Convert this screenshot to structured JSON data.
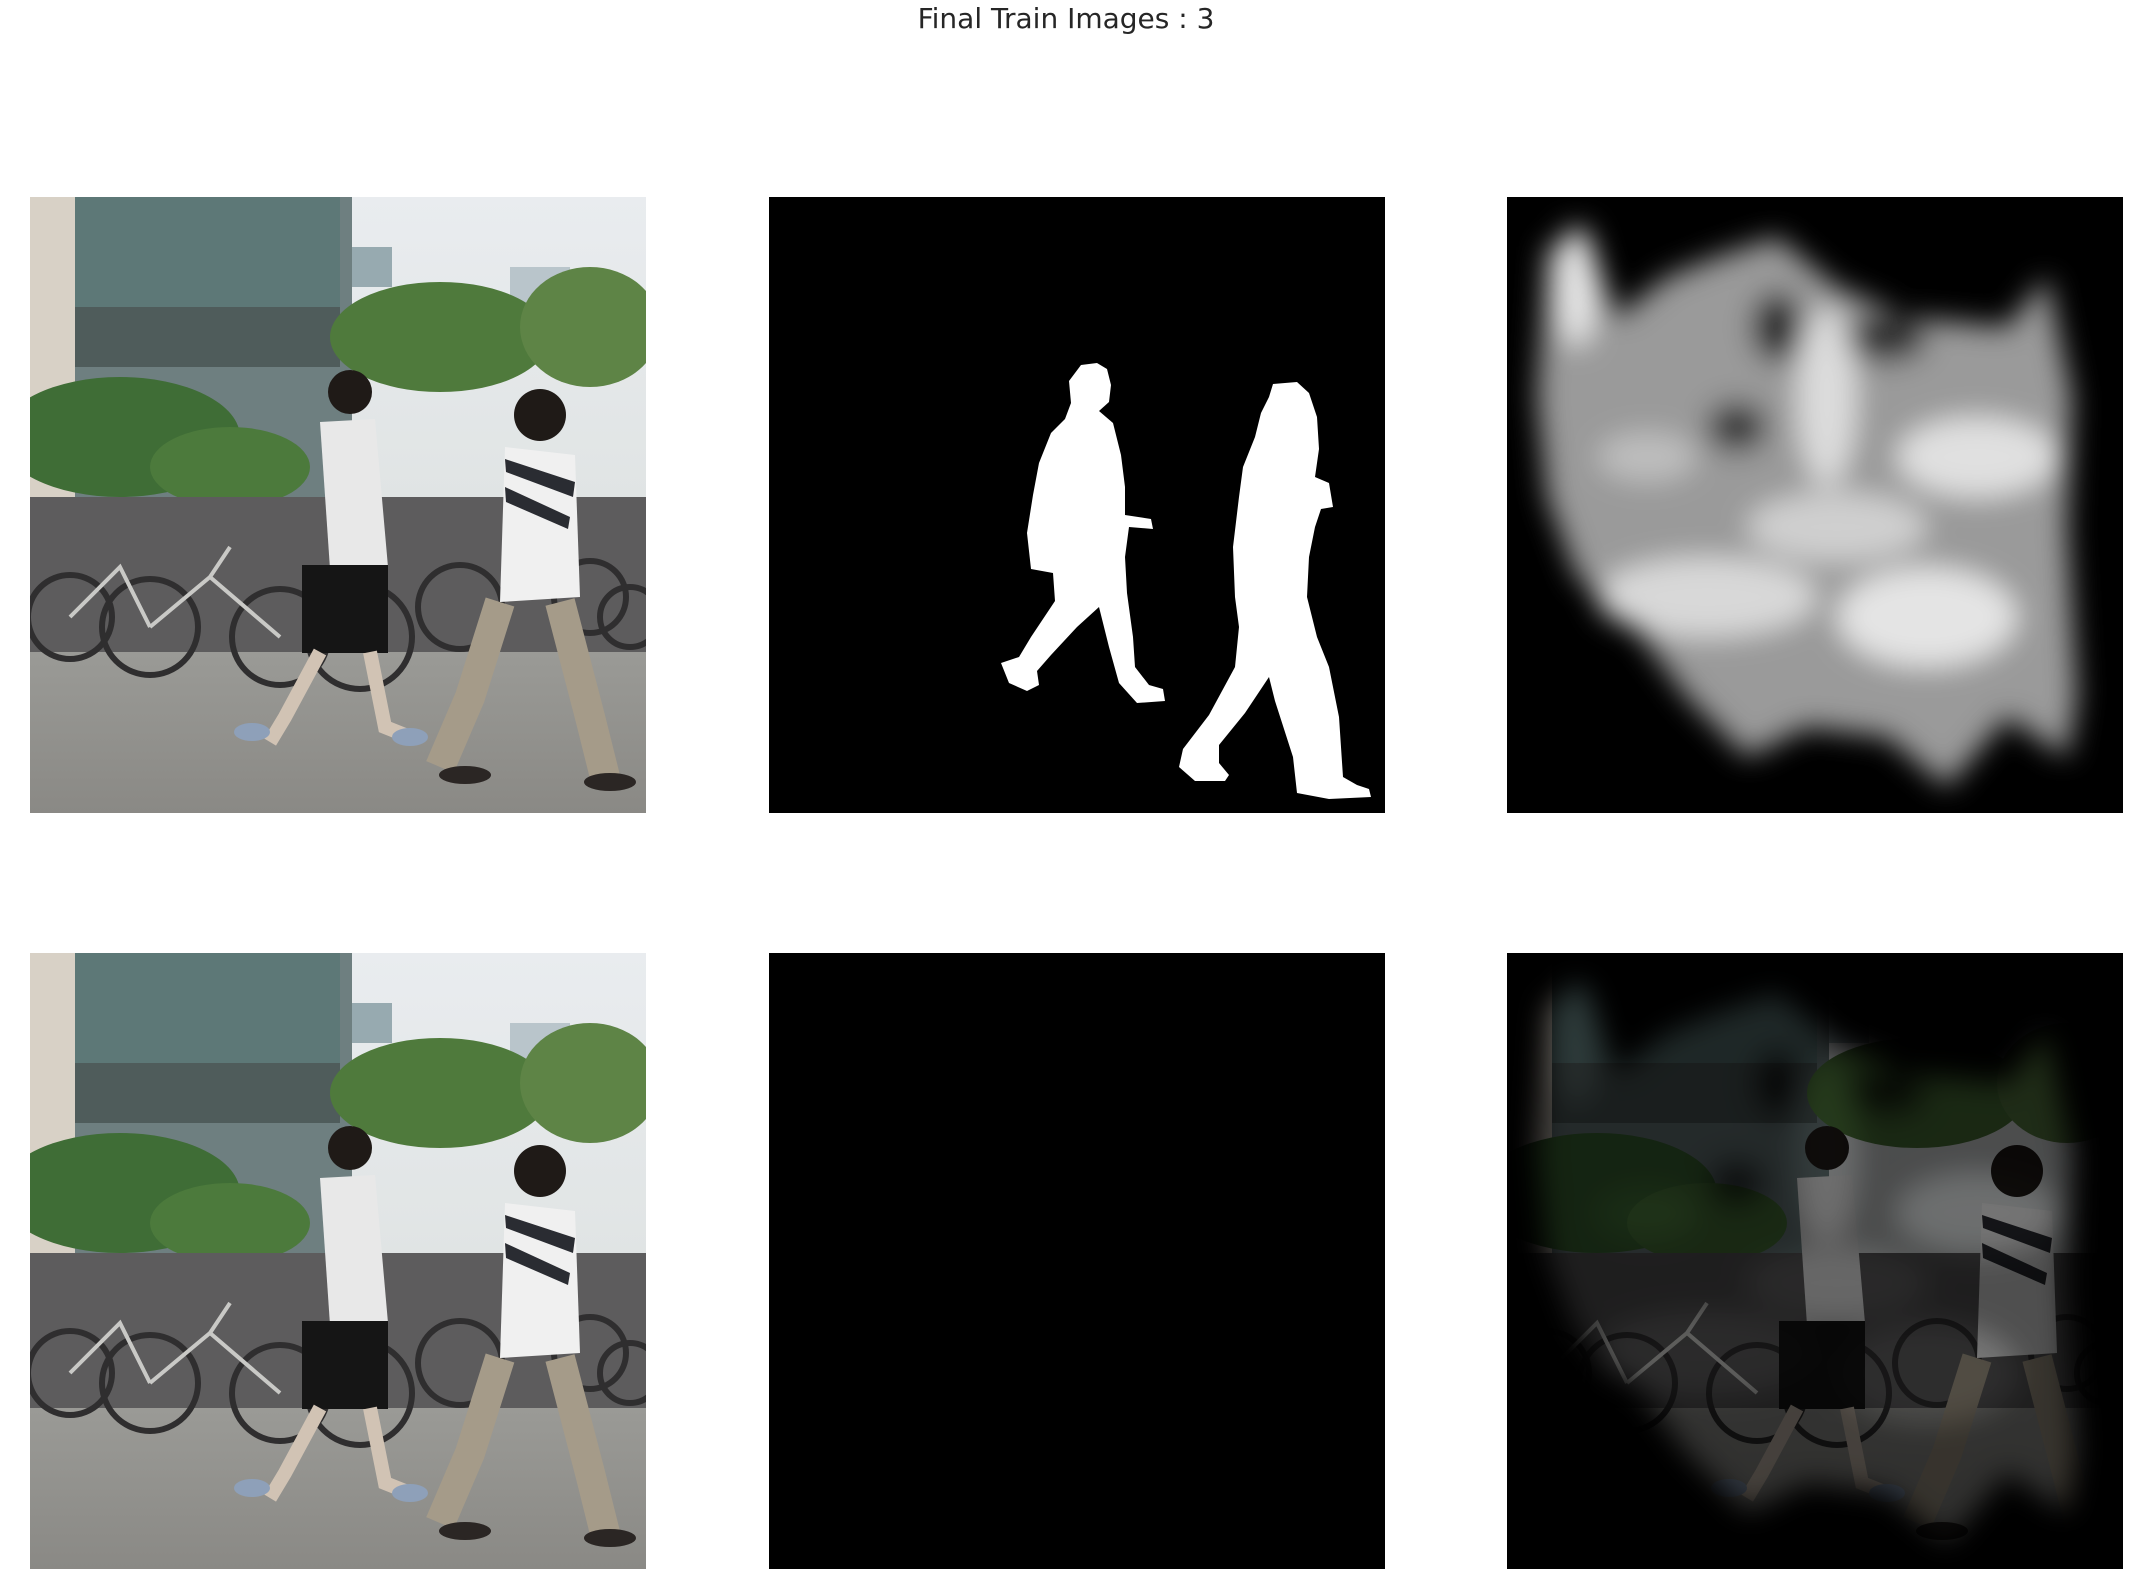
{
  "figure": {
    "title": "Final Train Images : 3"
  },
  "panels": [
    {
      "row": 1,
      "col": 1,
      "content": "original-photo"
    },
    {
      "row": 1,
      "col": 2,
      "content": "ground-truth-mask"
    },
    {
      "row": 1,
      "col": 3,
      "content": "predicted-mask"
    },
    {
      "row": 2,
      "col": 1,
      "content": "original-photo"
    },
    {
      "row": 2,
      "col": 2,
      "content": "masked-photo-ground-truth"
    },
    {
      "row": 2,
      "col": 3,
      "content": "masked-photo-predicted"
    }
  ],
  "colors": {
    "background": "#ffffff",
    "mask_background": "#000000",
    "mask_foreground": "#ffffff"
  }
}
